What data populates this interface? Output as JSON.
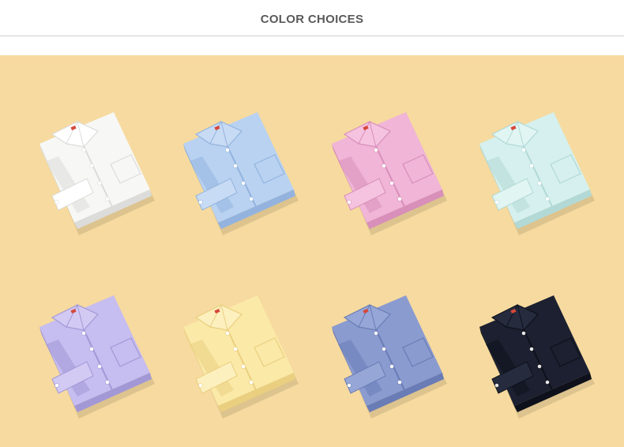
{
  "header": {
    "title": "COLOR CHOICES"
  },
  "background_color": "#f6da9f",
  "shirts": [
    {
      "color_name": "white",
      "body": "#f7f7f5",
      "shade": "#dcdcda",
      "collar": "#ffffff"
    },
    {
      "color_name": "light-blue",
      "body": "#b9d2f1",
      "shade": "#93b3de",
      "collar": "#c8dbf4"
    },
    {
      "color_name": "pink",
      "body": "#f0b5d7",
      "shade": "#d88fb9",
      "collar": "#f5c3e0"
    },
    {
      "color_name": "mint",
      "body": "#d5f0ee",
      "shade": "#b2d9d6",
      "collar": "#e1f5f3"
    },
    {
      "color_name": "lavender",
      "body": "#c6bdf0",
      "shade": "#a398d6",
      "collar": "#d2caf3"
    },
    {
      "color_name": "yellow",
      "body": "#fbe9a8",
      "shade": "#e9cf7f",
      "collar": "#fdf0bf"
    },
    {
      "color_name": "denim-blue",
      "body": "#8a9bd0",
      "shade": "#6a7cb6",
      "collar": "#96a6d6"
    },
    {
      "color_name": "navy",
      "body": "#1c2030",
      "shade": "#0e111b",
      "collar": "#262b3e"
    }
  ]
}
